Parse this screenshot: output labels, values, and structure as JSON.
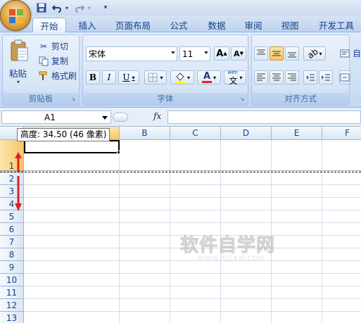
{
  "quick_access": {
    "icons": [
      "save-icon",
      "undo-icon",
      "redo-icon",
      "customize-icon"
    ]
  },
  "tabs": [
    {
      "label": "开始",
      "active": true
    },
    {
      "label": "插入"
    },
    {
      "label": "页面布局"
    },
    {
      "label": "公式"
    },
    {
      "label": "数据"
    },
    {
      "label": "审阅"
    },
    {
      "label": "视图"
    },
    {
      "label": "开发工具"
    }
  ],
  "clipboard": {
    "paste_label": "粘贴",
    "cut_label": "剪切",
    "copy_label": "复制",
    "format_painter_label": "格式刷",
    "group_label": "剪贴板"
  },
  "font": {
    "name": "宋体",
    "size": "11",
    "bold": "B",
    "italic": "I",
    "underline": "U",
    "fill_letter": "",
    "font_color_letter": "A",
    "phonetic_top": "wén",
    "phonetic_char": "文",
    "group_label": "字体",
    "grow_label": "A",
    "shrink_label": "A"
  },
  "alignment": {
    "group_label": "对齐方式",
    "wrap_label": "自"
  },
  "formula_bar": {
    "name_box": "A1",
    "fx": "fx"
  },
  "grid": {
    "columns": [
      "A",
      "B",
      "C",
      "D",
      "E",
      "F"
    ],
    "rows": [
      "1",
      "2",
      "3",
      "4",
      "5",
      "6",
      "7",
      "8",
      "9",
      "10",
      "11",
      "12",
      "13"
    ],
    "tooltip": "高度: 34.50 (46 像素)"
  },
  "watermark": {
    "title": "软件自学网",
    "url": "WWW.RJZXW.COM"
  },
  "colors": {
    "accent": "#15428b",
    "selected_header": "#f5c86a",
    "font_color_bar": "#e81c1c",
    "highlight_bar": "#ffff00",
    "arrow_red": "#e02020"
  }
}
